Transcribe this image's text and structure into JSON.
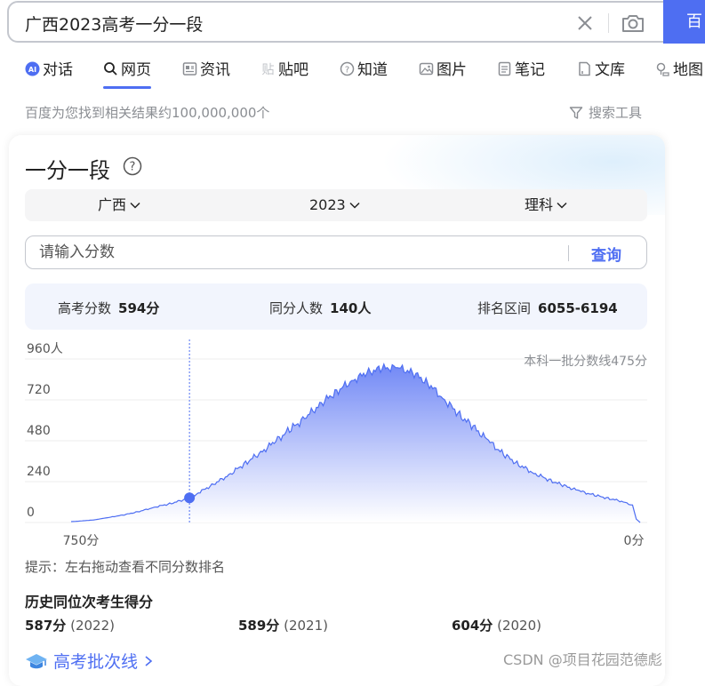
{
  "search": {
    "query": "广西2023高考一分一段",
    "button_label": "百"
  },
  "tabs": [
    {
      "label": "对话",
      "icon": "ai-icon"
    },
    {
      "label": "网页",
      "icon": "search-icon",
      "active": true
    },
    {
      "label": "资讯",
      "icon": "news-icon"
    },
    {
      "label": "贴吧",
      "icon": "tieba-icon"
    },
    {
      "label": "知道",
      "icon": "question-icon"
    },
    {
      "label": "图片",
      "icon": "image-icon"
    },
    {
      "label": "笔记",
      "icon": "note-icon"
    },
    {
      "label": "文库",
      "icon": "doc-icon"
    },
    {
      "label": "地图",
      "icon": "map-icon"
    }
  ],
  "results": {
    "count_text": "百度为您找到相关结果约100,000,000个",
    "tools_label": "搜索工具"
  },
  "card": {
    "title": "一分一段",
    "filters": {
      "province": "广西",
      "year": "2023",
      "subject": "理科"
    },
    "input_placeholder": "请输入分数",
    "query_label": "查询",
    "stats": {
      "score_label": "高考分数",
      "score_value": "594分",
      "same_label": "同分人数",
      "same_value": "140人",
      "rank_label": "排名区间",
      "rank_value": "6055-6194"
    },
    "hint": "提示：左右拖动查看不同分数排名",
    "history_title": "历史同位次考生得分",
    "history": [
      {
        "score": "587分",
        "year": "(2022)"
      },
      {
        "score": "589分",
        "year": "(2021)"
      },
      {
        "score": "604分",
        "year": "(2020)"
      }
    ],
    "batch_link": "高考批次线"
  },
  "chart_data": {
    "type": "area",
    "y_ticks": [
      "960人",
      "720",
      "480",
      "240",
      "0"
    ],
    "x_start_label": "750分",
    "x_end_label": "0分",
    "annotation": "本科一批分数线475分",
    "xlim": [
      750,
      0
    ],
    "ylim": [
      0,
      960
    ],
    "selected_score": 594,
    "x": [
      750,
      740,
      720,
      700,
      680,
      660,
      640,
      620,
      600,
      594,
      580,
      560,
      540,
      520,
      500,
      480,
      460,
      440,
      420,
      400,
      380,
      360,
      340,
      320,
      300,
      280,
      260,
      240,
      220,
      200,
      180,
      160,
      140,
      120,
      100,
      80,
      60,
      40,
      20,
      10,
      5,
      0
    ],
    "y": [
      5,
      8,
      15,
      30,
      45,
      65,
      90,
      110,
      135,
      145,
      180,
      230,
      285,
      350,
      410,
      480,
      550,
      620,
      700,
      770,
      830,
      880,
      905,
      910,
      880,
      820,
      730,
      640,
      560,
      480,
      400,
      340,
      290,
      250,
      215,
      185,
      160,
      140,
      120,
      100,
      20,
      0
    ],
    "colors": {
      "line": "#4e6ef2",
      "fill_top": "#6a82f5",
      "fill_bottom": "#ffffff",
      "marker": "#4e6ef2"
    }
  },
  "watermark": "CSDN @项目花园范德彪"
}
